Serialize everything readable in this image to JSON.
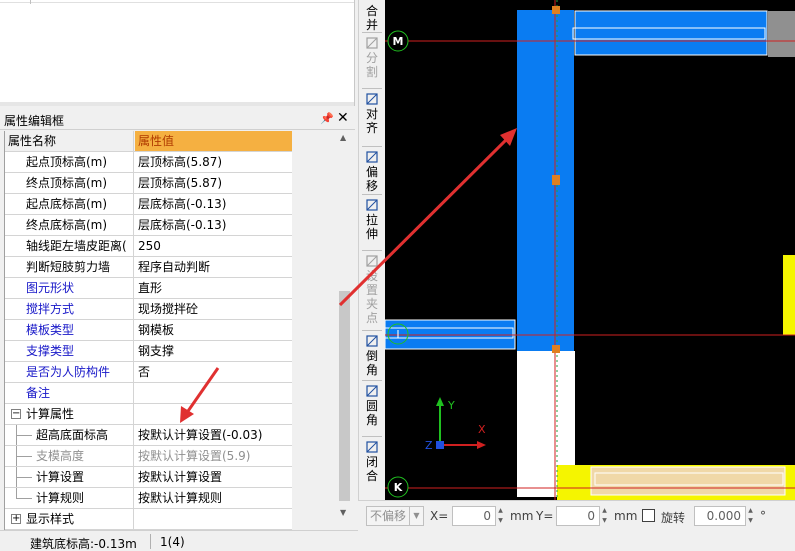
{
  "property_editor": {
    "title": "属性编辑框",
    "pin_icon": "pin-icon",
    "close_icon": "close-icon",
    "header": {
      "name": "属性名称",
      "value": "属性值"
    },
    "rows": [
      {
        "name": "起点顶标高(m)",
        "value": "层顶标高(5.87)",
        "style": "normal"
      },
      {
        "name": "终点顶标高(m)",
        "value": "层顶标高(5.87)",
        "style": "normal"
      },
      {
        "name": "起点底标高(m)",
        "value": "层底标高(-0.13)",
        "style": "normal"
      },
      {
        "name": "终点底标高(m)",
        "value": "层底标高(-0.13)",
        "style": "normal"
      },
      {
        "name": "轴线距左墙皮距离(",
        "value": "250",
        "style": "normal"
      },
      {
        "name": "判断短肢剪力墙",
        "value": "程序自动判断",
        "style": "normal"
      },
      {
        "name": "图元形状",
        "value": "直形",
        "style": "blue"
      },
      {
        "name": "搅拌方式",
        "value": "现场搅拌砼",
        "style": "blue"
      },
      {
        "name": "模板类型",
        "value": "钢模板",
        "style": "blue"
      },
      {
        "name": "支撑类型",
        "value": "钢支撑",
        "style": "blue"
      },
      {
        "name": "是否为人防构件",
        "value": "否",
        "style": "blue"
      },
      {
        "name": "备注",
        "value": "",
        "style": "blue"
      }
    ],
    "group_calc": {
      "label": "计算属性",
      "expander": "−",
      "children": [
        {
          "name": "超高底面标高",
          "value": "按默认计算设置(-0.03)",
          "style": "normal"
        },
        {
          "name": "支模高度",
          "value": "按默认计算设置(5.9)",
          "style": "grey"
        },
        {
          "name": "计算设置",
          "value": "按默认计算设置",
          "style": "normal"
        },
        {
          "name": "计算规则",
          "value": "按默认计算规则",
          "style": "normal"
        }
      ]
    },
    "group_display": {
      "label": "显示样式",
      "expander": "+"
    }
  },
  "status_bar": {
    "elevation": "建筑底标高:-0.13m",
    "count": "1(4)"
  },
  "vertical_toolbar": [
    {
      "label": [
        "合",
        "并"
      ],
      "icon": "merge-icon",
      "enabled": true
    },
    {
      "label": [
        "分",
        "割"
      ],
      "icon": "split-icon",
      "enabled": false
    },
    {
      "label": [
        "对",
        "齐"
      ],
      "icon": "align-icon",
      "enabled": true
    },
    {
      "label": [
        "偏",
        "移"
      ],
      "icon": "offset-icon",
      "enabled": true
    },
    {
      "label": [
        "拉",
        "伸"
      ],
      "icon": "stretch-icon",
      "enabled": true
    },
    {
      "label": [
        "设",
        "置",
        "夹",
        "点"
      ],
      "icon": "set-grip-icon",
      "enabled": false
    },
    {
      "label": [
        "倒",
        "角"
      ],
      "icon": "chamfer-icon",
      "enabled": true
    },
    {
      "label": [
        "圆",
        "角"
      ],
      "icon": "fillet-icon",
      "enabled": true
    },
    {
      "label": [
        "闭",
        "合"
      ],
      "icon": "close-shape-icon",
      "enabled": true
    }
  ],
  "canvas": {
    "axis_labels": {
      "m": "M",
      "i": "I",
      "k": "K"
    },
    "ucs": {
      "x": "X",
      "y": "Y",
      "z": "Z"
    },
    "colors": {
      "wall_blue": "#0a7cf2",
      "grid_red": "#d02020",
      "grip_orange": "#e08020",
      "yellow": "#f5f500",
      "tan": "#f0d8a8",
      "axis_circle": "#20c020"
    }
  },
  "bottom_toolbar": {
    "offset_mode": "不偏移",
    "x_label": "X=",
    "x_value": "0",
    "x_unit": "mm",
    "y_label": "Y=",
    "y_value": "0",
    "y_unit": "mm",
    "rotate_label": "旋转",
    "rotate_value": "0.000",
    "degree": "°"
  }
}
